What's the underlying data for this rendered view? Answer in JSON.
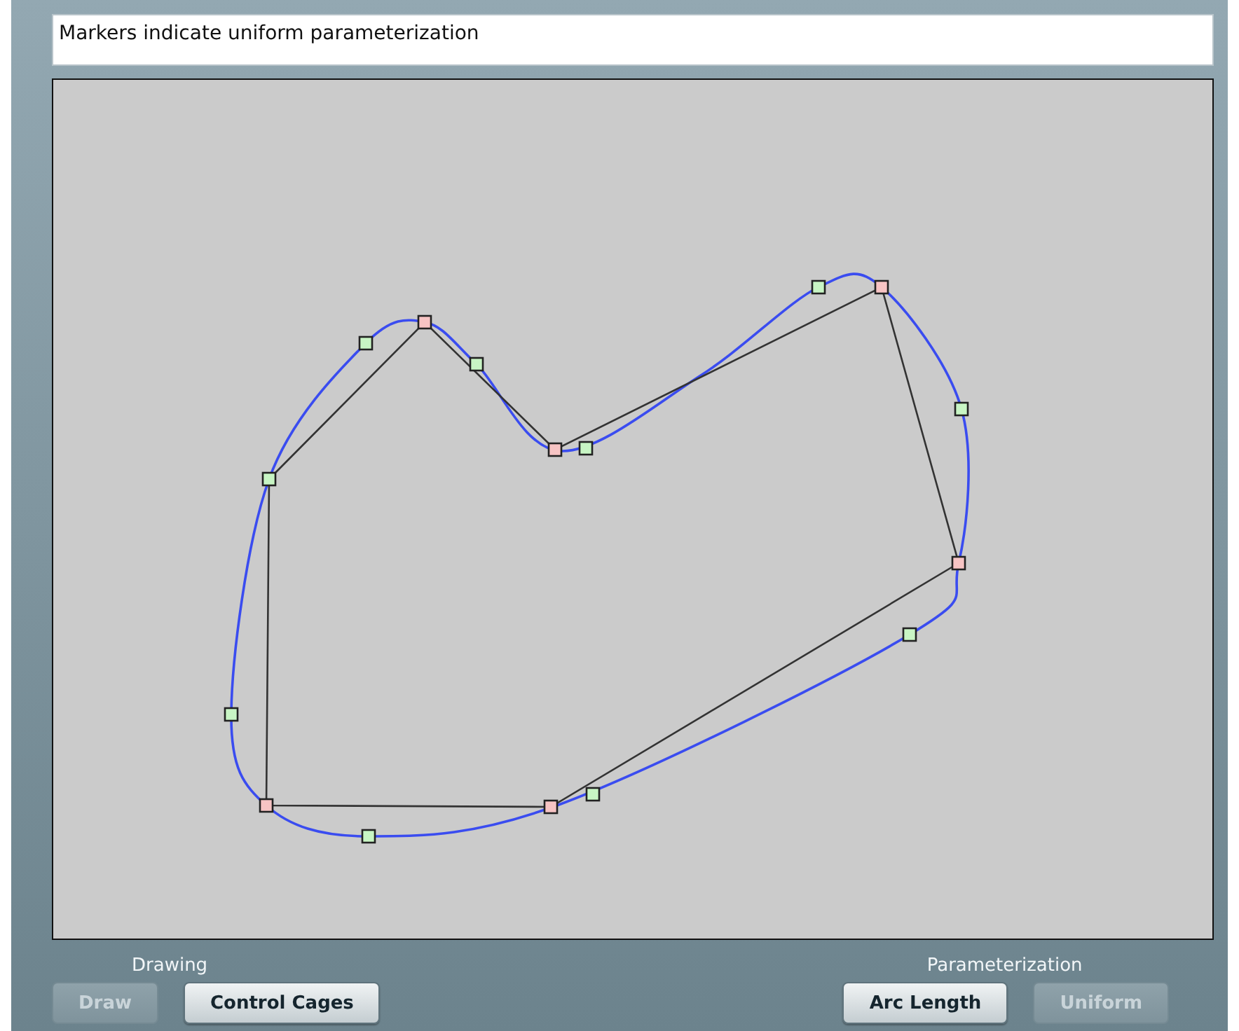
{
  "message": "Markers indicate uniform parameterization",
  "groups": [
    {
      "label": "Drawing",
      "buttons": [
        {
          "label": "Draw",
          "disabled": true
        },
        {
          "label": "Control Cages",
          "disabled": false
        }
      ]
    },
    {
      "label": "Parameterization",
      "buttons": [
        {
          "label": "Arc Length",
          "disabled": false
        },
        {
          "label": "Uniform",
          "disabled": true
        }
      ]
    }
  ]
}
